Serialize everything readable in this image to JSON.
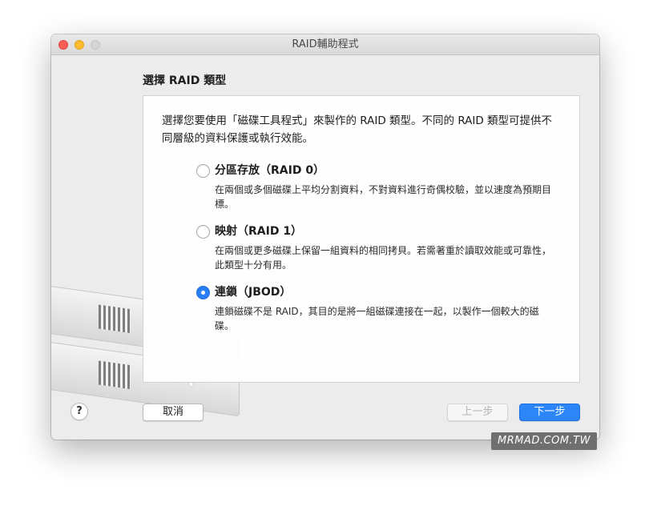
{
  "window": {
    "title": "RAID輔助程式"
  },
  "section_title": "選擇 RAID 類型",
  "intro_text": "選擇您要使用「磁碟工具程式」來製作的 RAID 類型。不同的 RAID 類型可提供不同層級的資料保護或執行效能。",
  "options": [
    {
      "label": "分區存放（RAID 0）",
      "description": "在兩個或多個磁碟上平均分割資料，不對資料進行奇偶校驗，並以速度為預期目標。",
      "selected": false
    },
    {
      "label": "映射（RAID 1）",
      "description": "在兩個或更多磁碟上保留一組資料的相同拷貝。若需著重於讀取效能或可靠性，此類型十分有用。",
      "selected": false
    },
    {
      "label": "連鎖（JBOD）",
      "description": "連鎖磁碟不是 RAID，其目的是將一組磁碟連接在一起，以製作一個較大的磁碟。",
      "selected": true
    }
  ],
  "buttons": {
    "help": "?",
    "cancel": "取消",
    "previous": "上一步",
    "next": "下一步"
  },
  "watermark": "MRMAD.COM.TW",
  "colors": {
    "accent": "#2d86f7",
    "close": "#fd5f57",
    "minimize": "#febc2e",
    "zoom": "#d4d4d4"
  }
}
